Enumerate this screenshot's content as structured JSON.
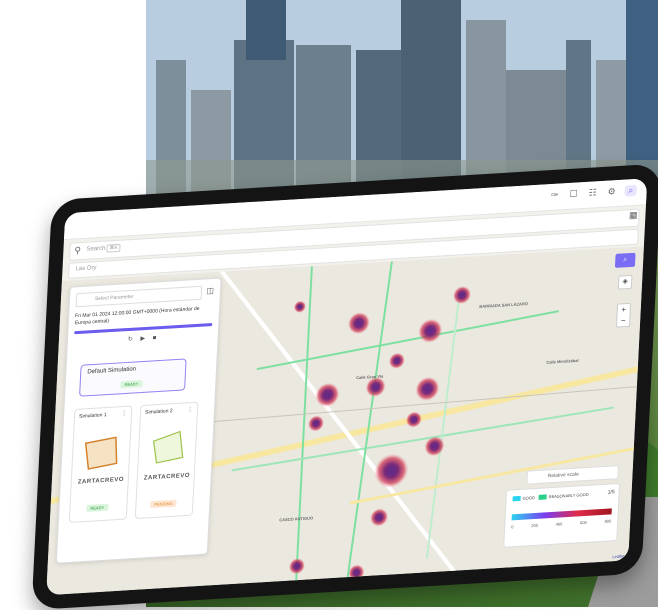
{
  "topbar": {
    "icons": [
      "✑",
      "☐",
      "☷",
      "⚙",
      "⌕"
    ]
  },
  "search": {
    "label": "Search",
    "badge": "⌘K",
    "icon": "search-icon"
  },
  "location": {
    "placeholder": "Las Ory"
  },
  "panel": {
    "select_placeholder": "Select Parameter",
    "date_text": "Fri Mar 01 2024 12:00:00 GMT+0000 (Hora estándar de Europa central)",
    "progress": 1.0,
    "controls": "↻ ▶ ■",
    "default_simulation": {
      "title": "Default Simulation",
      "status": "READY"
    },
    "simulations": [
      {
        "title": "Simulation 1",
        "logo": "ZARTACREVO",
        "status": "READY"
      },
      {
        "title": "Simulation 2",
        "logo": "ZARTACREVO",
        "status": "PENDING"
      }
    ]
  },
  "map_controls": {
    "search": "⌕",
    "layers": "◈",
    "zoom_in": "+",
    "zoom_out": "−"
  },
  "map_labels": [
    {
      "text": "BARRIADA SAN LÁZARO",
      "key": "a"
    },
    {
      "text": "Calle Gran Vía",
      "key": "b"
    },
    {
      "text": "CASCO ANTIGUO",
      "key": "c"
    },
    {
      "text": "Calle Mendizábal",
      "key": "d"
    }
  ],
  "relative_scale": "Relative scale",
  "legend": {
    "good": "GOOD",
    "reasonably_good": "REASONABLY GOOD",
    "page": "1/5",
    "ticks": [
      "0",
      "200",
      "400",
      "600",
      "800"
    ],
    "colors": {
      "good": "#2bd3ef",
      "reasonably_good": "#2ad089"
    }
  },
  "attribution": "Leaflet",
  "accent": "#6b5cf0"
}
